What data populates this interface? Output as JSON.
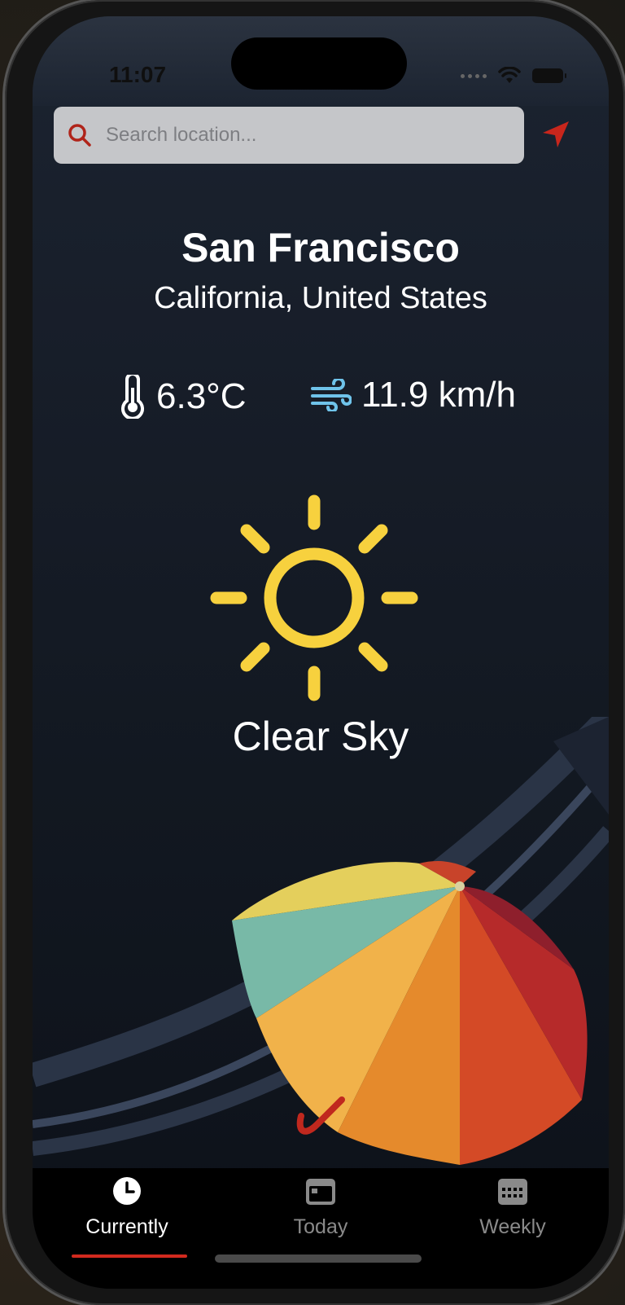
{
  "status_bar": {
    "time": "11:07"
  },
  "search": {
    "placeholder": "Search location...",
    "value": ""
  },
  "location": {
    "city": "San Francisco",
    "region": "California, United States"
  },
  "weather": {
    "temperature": "6.3°C",
    "wind": "11.9 km/h",
    "condition": "Clear Sky",
    "condition_icon": "sun-icon"
  },
  "tabs": [
    {
      "label": "Currently",
      "icon": "clock-icon",
      "active": true
    },
    {
      "label": "Today",
      "icon": "calendar-icon",
      "active": false
    },
    {
      "label": "Weekly",
      "icon": "calendar-grid-icon",
      "active": false
    }
  ],
  "colors": {
    "accent": "#d12a1e",
    "sun": "#f7d13e",
    "wind_icon": "#6fc3ea"
  }
}
